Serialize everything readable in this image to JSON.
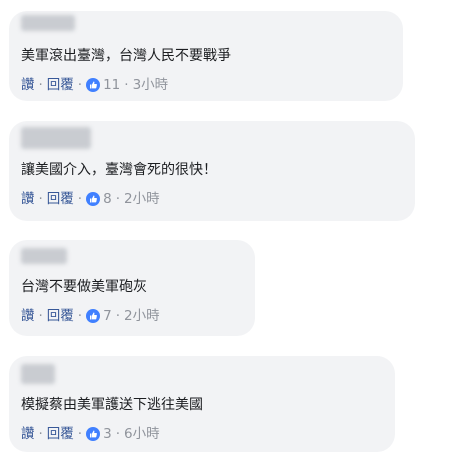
{
  "comments": [
    {
      "text": "美軍滾出臺灣，台灣人民不要戰爭",
      "like_label": "讚",
      "reply_label": "回覆",
      "likes": "11",
      "time": "3小時"
    },
    {
      "text": "讓美國介入，臺灣會死的很快！",
      "like_label": "讚",
      "reply_label": "回覆",
      "likes": "8",
      "time": "2小時"
    },
    {
      "text": "台灣不要做美軍砲灰",
      "like_label": "讚",
      "reply_label": "回覆",
      "likes": "7",
      "time": "2小時"
    },
    {
      "text": "模擬蔡由美軍護送下逃往美國",
      "like_label": "讚",
      "reply_label": "回覆",
      "likes": "3",
      "time": "6小時"
    }
  ],
  "separator": "·",
  "colors": {
    "link": "#385898",
    "muted": "#90949c",
    "bubble": "#f2f3f5",
    "like_icon": "#4080ff"
  }
}
